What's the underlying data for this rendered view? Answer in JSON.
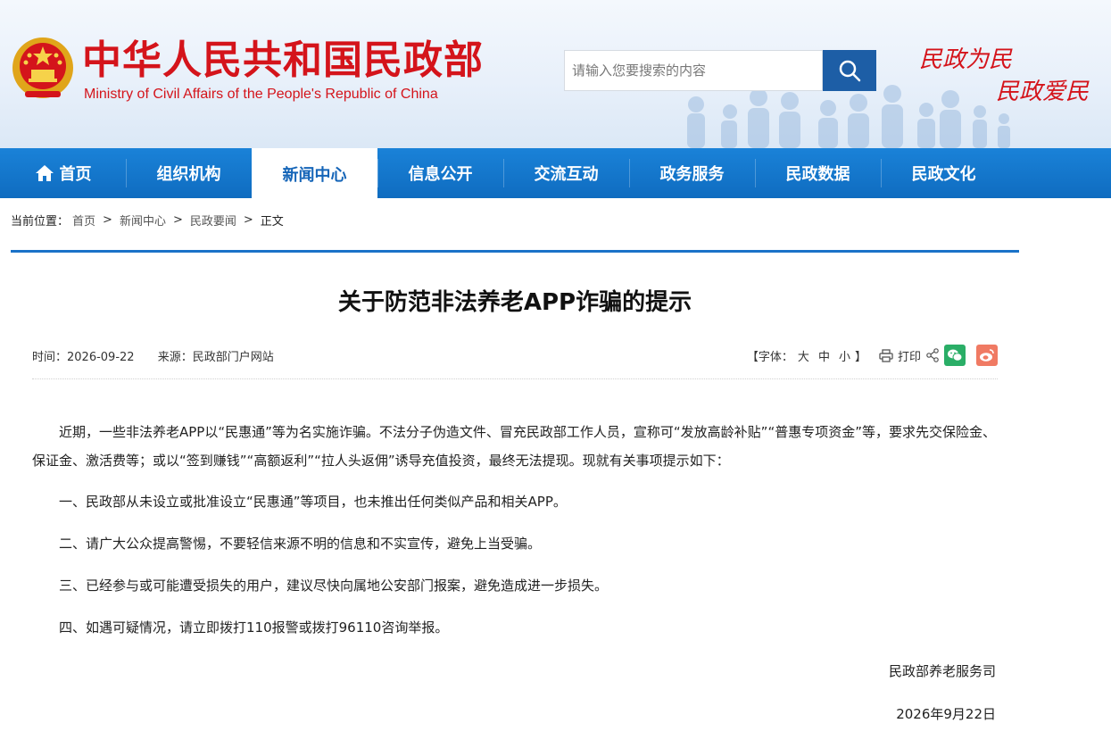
{
  "header": {
    "title_cn": "中华人民共和国民政部",
    "title_en": "Ministry of Civil Affairs of the People's Republic of China",
    "search_placeholder": "请输入您要搜索的内容",
    "slogan_line1": "民政为民",
    "slogan_line2": "民政爱民"
  },
  "nav": {
    "items": [
      {
        "label": "首页",
        "icon": "home-icon"
      },
      {
        "label": "组织机构"
      },
      {
        "label": "新闻中心",
        "active": true
      },
      {
        "label": "信息公开"
      },
      {
        "label": "交流互动"
      },
      {
        "label": "政务服务"
      },
      {
        "label": "民政数据"
      },
      {
        "label": "民政文化"
      }
    ]
  },
  "breadcrumb": {
    "label": "当前位置：",
    "items": [
      "首页",
      "新闻中心",
      "民政要闻"
    ],
    "separator": ">",
    "current": "正文"
  },
  "article": {
    "title": "关于防范非法养老APP诈骗的提示",
    "date": "时间：2026-09-22",
    "source": "来源：民政部门户网站",
    "font_label_open": "【字体：",
    "font_sizes": [
      "大",
      "中",
      "小"
    ],
    "font_label_close": "】",
    "print_label": "打印",
    "paragraphs": [
      "近期，一些非法养老APP以“民惠通”等为名实施诈骗。不法分子伪造文件、冒充民政部工作人员，宣称可“发放高龄补贴”“普惠专项资金”等，要求先交保险金、保证金、激活费等；或以“签到赚钱”“高额返利”“拉人头返佣”诱导充值投资，最终无法提现。现就有关事项提示如下：",
      "一、民政部从未设立或批准设立“民惠通”等项目，也未推出任何类似产品和相关APP。",
      "二、请广大公众提高警惕，不要轻信来源不明的信息和不实宣传，避免上当受骗。",
      "三、已经参与或可能遭受损失的用户，建议尽快向属地公安部门报案，避免造成进一步损失。",
      "四、如遇可疑情况，请立即拨打110报警或拨打96110咨询举报。"
    ],
    "signature": "民政部养老服务司",
    "sign_date": "2026年9月22日"
  },
  "colors": {
    "brand_red": "#d4141b",
    "nav_blue": "#0f6cc0",
    "search_button": "#1d5ea6",
    "wechat_green": "#2aae67",
    "weibo_orange": "#f07a63"
  }
}
